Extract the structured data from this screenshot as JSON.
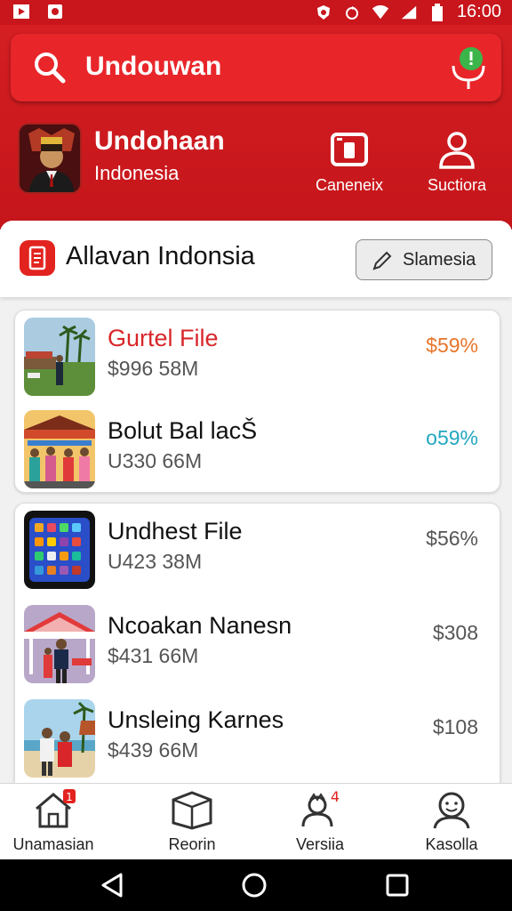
{
  "status_bar": {
    "time": "16:00"
  },
  "search": {
    "query": "Undouwan"
  },
  "profile": {
    "title": "Undohaan",
    "subtitle": "Indonesia"
  },
  "header_actions": [
    {
      "label": "Caneneix",
      "icon": "camera-icon"
    },
    {
      "label": "Suctiora",
      "icon": "user-icon"
    }
  ],
  "section": {
    "title": "Allavan Indonsia",
    "button_label": "Slamesia"
  },
  "list_group_1": [
    {
      "title": "Gurtel File",
      "subtitle": "$996 58M",
      "value": "$59%",
      "value_color": "#e8752a",
      "title_color": "#d8262a"
    },
    {
      "title": "Bolut Bal lacŠ",
      "subtitle": "U330 66M",
      "value": "o59%",
      "value_color": "#22a7c0",
      "title_color": "#111111"
    }
  ],
  "list_group_2": [
    {
      "title": "Undhest File",
      "subtitle": "U423 38M",
      "value": "$56%",
      "value_color": "#555555"
    },
    {
      "title": "Ncoakan Nanesn",
      "subtitle": "$431 66M",
      "value": "$308",
      "value_color": "#555555"
    },
    {
      "title": "Unsleing Karnes",
      "subtitle": "$439 66M",
      "value": "$108",
      "value_color": "#555555"
    }
  ],
  "bottom_nav": [
    {
      "label": "Unamasian",
      "icon": "home-icon",
      "badge": "1"
    },
    {
      "label": "Reorin",
      "icon": "box-icon"
    },
    {
      "label": "Versiia",
      "icon": "people-icon",
      "badge": "4"
    },
    {
      "label": "Kasolla",
      "icon": "smiley-icon"
    }
  ],
  "colors": {
    "brand_red": "#d41e22",
    "accent_green": "#3bb54a"
  }
}
